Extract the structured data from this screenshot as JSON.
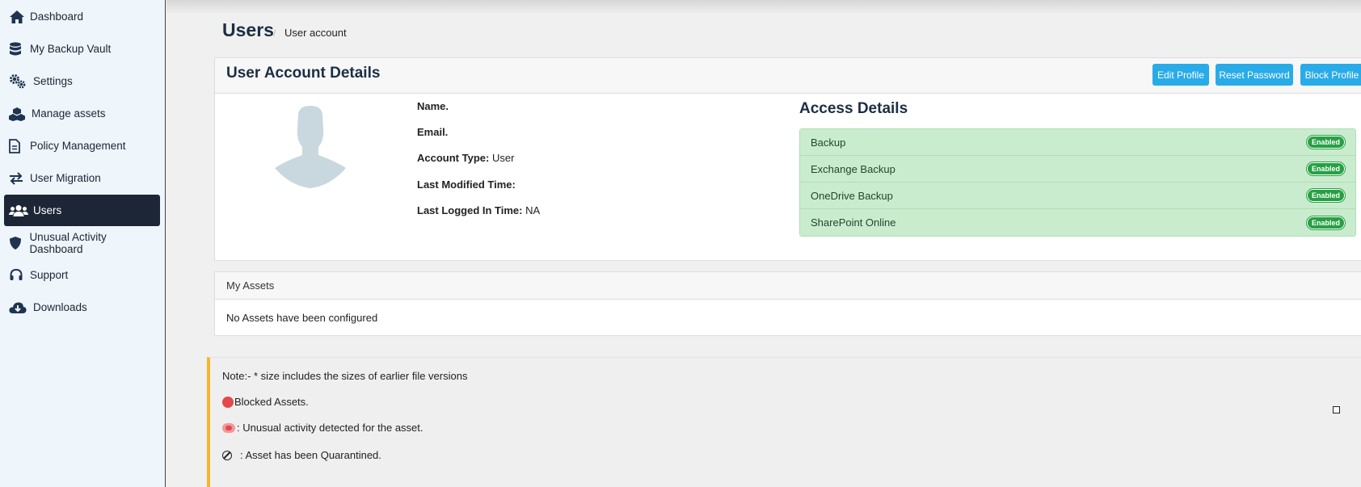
{
  "sidebar": {
    "items": [
      {
        "label": "Dashboard",
        "icon": "home-icon"
      },
      {
        "label": "My Backup Vault",
        "icon": "database-icon"
      },
      {
        "label": "Settings",
        "icon": "gears-icon"
      },
      {
        "label": "Manage assets",
        "icon": "boxes-icon"
      },
      {
        "label": "Policy Management",
        "icon": "document-icon"
      },
      {
        "label": "User Migration",
        "icon": "exchange-arrows-icon"
      },
      {
        "label": "Users",
        "icon": "users-icon",
        "active": true
      },
      {
        "label": "Unusual Activity Dashboard",
        "icon": "shield-icon"
      },
      {
        "label": "Support",
        "icon": "headset-icon"
      },
      {
        "label": "Downloads",
        "icon": "cloud-download-icon"
      }
    ]
  },
  "header": {
    "title": "Users",
    "separator": "/",
    "breadcrumb": "User account"
  },
  "account": {
    "title": "User Account Details",
    "buttons": {
      "edit": "Edit Profile",
      "reset": "Reset Password",
      "block": "Block Profile"
    },
    "fields": [
      {
        "label": "Name.",
        "value": ""
      },
      {
        "label": "Email.",
        "value": ""
      },
      {
        "label": "Account Type:",
        "value": "User"
      },
      {
        "label": "Last Modified Time:",
        "value": ""
      },
      {
        "label": "Last Logged In Time:",
        "value": "NA"
      }
    ]
  },
  "access": {
    "title": "Access Details",
    "items": [
      {
        "label": "Backup",
        "status": "Enabled"
      },
      {
        "label": "Exchange Backup",
        "status": "Enabled"
      },
      {
        "label": "OneDrive Backup",
        "status": "Enabled"
      },
      {
        "label": "SharePoint Online",
        "status": "Enabled"
      }
    ]
  },
  "assets": {
    "title": "My Assets",
    "empty": "No Assets have been configured"
  },
  "note": {
    "line1": "Note:- * size includes the sizes of earlier file versions",
    "line2": "Blocked Assets.",
    "line3": ": Unusual activity detected for the asset.",
    "line4": ": Asset has been Quarantined."
  },
  "colors": {
    "accent": "#29abe8",
    "sidebar_active": "#1c2637",
    "enabled_badge": "#27a044",
    "access_bg": "#c9ecce",
    "note_border": "#f7b52d",
    "blocked": "#e4484b"
  }
}
